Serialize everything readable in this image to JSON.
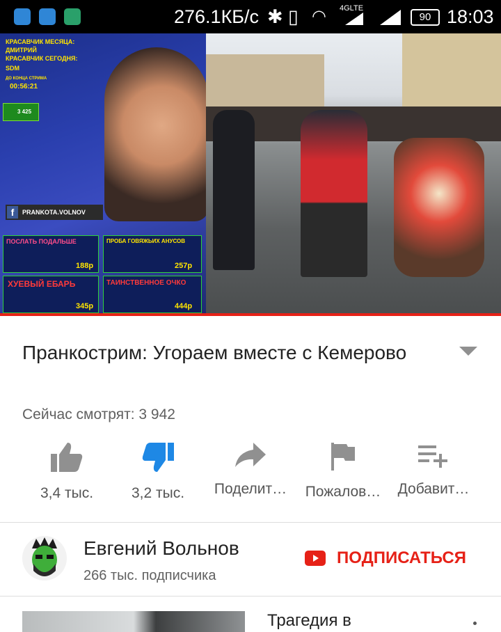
{
  "status_bar": {
    "speed": "276.1КБ/с",
    "network": "4GLTE",
    "battery": "90",
    "time": "18:03"
  },
  "video": {
    "overlay": {
      "month_label": "КРАСАВЧИК МЕСЯЦА:",
      "month_name": "ДМИТРИЙ",
      "today_label": "КРАСАВЧИК СЕГОДНЯ:",
      "today_name": "SDM",
      "timer_label": "ДО КОНЦА СТРИМА",
      "timer": "00:56:21",
      "likes": "3 425",
      "facebook": "PRANKOTA.VOLNOV",
      "tile1_title": "ПОСЛАТЬ ПОДАЛЬШЕ",
      "tile1_price": "188р",
      "tile2_title": "ПРОБА ГОВЯЖЬИХ АНУСОВ",
      "tile2_price": "257р",
      "tile3_title": "ХУЕВЫЙ ЕБАРЬ",
      "tile3_price": "345р",
      "tile4_title": "ТАИНСТВЕННОЕ ОЧКО",
      "tile4_price": "444р"
    }
  },
  "info": {
    "title": "Пранкострим: Угораем вместе с Кемерово",
    "viewers": "Сейчас смотрят: 3 942"
  },
  "actions": {
    "like": "3,4 тыс.",
    "dislike": "3,2 тыс.",
    "share": "Поделит…",
    "report": "Пожалов…",
    "add": "Добавит…"
  },
  "channel": {
    "name": "Евгений Вольнов",
    "subscribers": "266 тыс. подписчика",
    "subscribe_label": "ПОДПИСАТЬСЯ"
  },
  "next": {
    "title": "Трагедия в"
  },
  "colors": {
    "accent": "#e62117",
    "dislike_active": "#1e88e5",
    "icon_grey": "#909090"
  }
}
